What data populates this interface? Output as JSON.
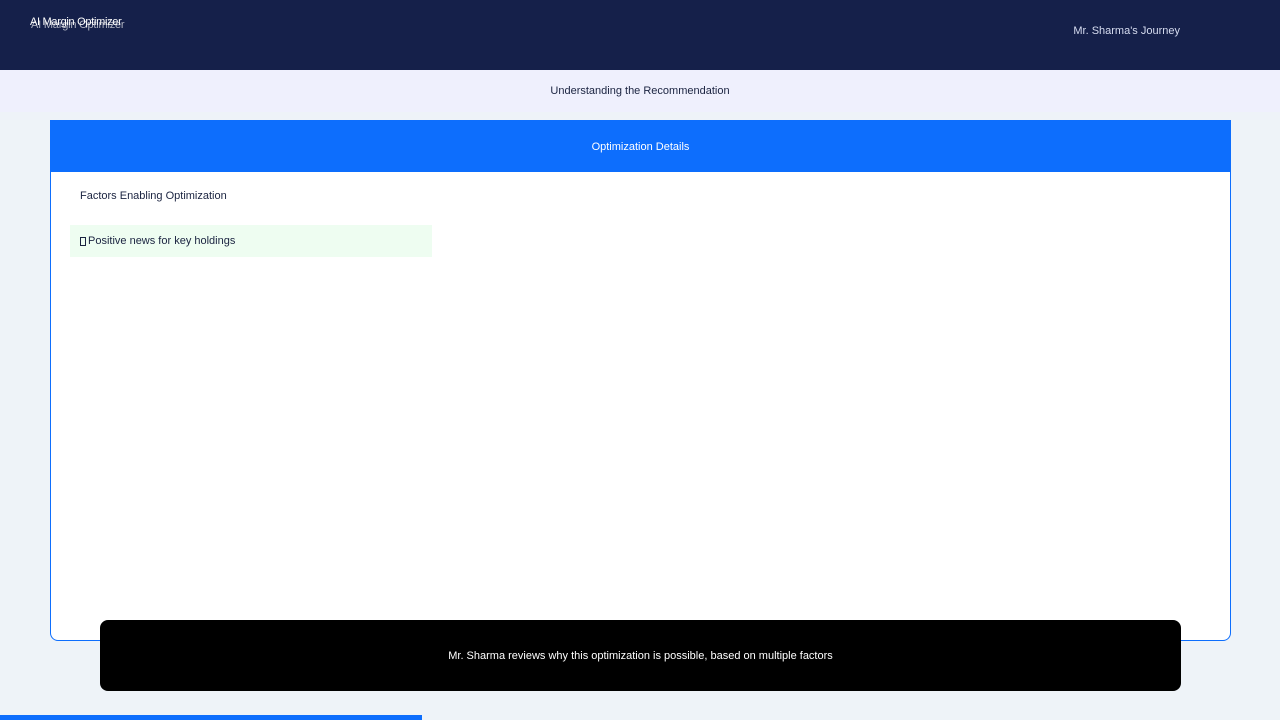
{
  "header": {
    "app_name": "AI Margin Optimizer",
    "journey_label": "Mr. Sharma's Journey"
  },
  "subheader": {
    "title": "Understanding the Recommendation"
  },
  "panel": {
    "title": "Optimization Details",
    "section_title": "Factors Enabling Optimization",
    "factors": [
      {
        "icon": "checkbox-icon",
        "label": "Positive news for key holdings"
      }
    ]
  },
  "caption": {
    "text": "Mr. Sharma reviews why this optimization is possible, based on multiple factors"
  },
  "progress": {
    "fraction": 0.33
  },
  "colors": {
    "topbar": "#15204a",
    "accent": "#0d6efd",
    "factor_bg": "#eefdf1",
    "subheader_bg": "#eff0fd"
  }
}
